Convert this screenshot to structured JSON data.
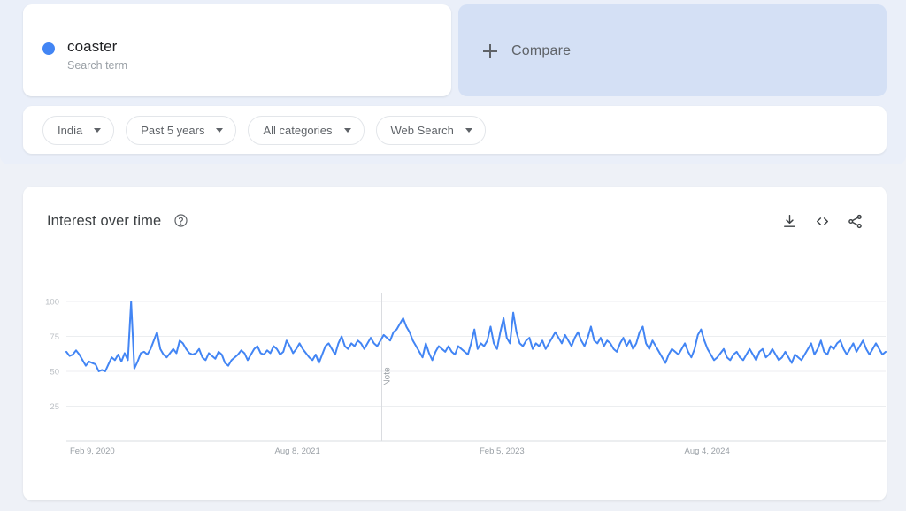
{
  "search_term": {
    "label": "coaster",
    "sublabel": "Search term",
    "dot_color": "#4285f4"
  },
  "compare": {
    "label": "Compare",
    "icon": "plus-icon"
  },
  "filters": [
    {
      "label": "India",
      "icon": "chevron-down-icon"
    },
    {
      "label": "Past 5 years",
      "icon": "chevron-down-icon"
    },
    {
      "label": "All categories",
      "icon": "chevron-down-icon"
    },
    {
      "label": "Web Search",
      "icon": "chevron-down-icon"
    }
  ],
  "chart_card": {
    "title": "Interest over time",
    "help_icon": "help-circle-icon",
    "actions": [
      {
        "name": "download-icon",
        "label": "Download"
      },
      {
        "name": "embed-code-icon",
        "label": "Embed"
      },
      {
        "name": "share-icon",
        "label": "Share"
      }
    ]
  },
  "chart_data": {
    "type": "line",
    "title": "Interest over time",
    "xlabel": "",
    "ylabel": "",
    "ylim": [
      0,
      100
    ],
    "yticks": [
      25,
      50,
      75,
      100
    ],
    "grid": true,
    "legend_position": "none",
    "line_color": "#4285f4",
    "xticks": [
      "Feb 9, 2020",
      "Aug 8, 2021",
      "Feb 5, 2023",
      "Aug 4, 2024"
    ],
    "annotations": [
      {
        "label": "Note",
        "x_fraction": 0.385,
        "orientation": "vertical"
      }
    ],
    "series": [
      {
        "name": "coaster",
        "values": [
          64,
          61,
          62,
          65,
          62,
          58,
          54,
          57,
          56,
          55,
          50,
          51,
          50,
          55,
          60,
          58,
          62,
          57,
          63,
          58,
          100,
          52,
          57,
          63,
          64,
          62,
          66,
          72,
          78,
          66,
          62,
          60,
          63,
          66,
          63,
          72,
          70,
          66,
          63,
          62,
          63,
          66,
          60,
          58,
          63,
          61,
          59,
          64,
          62,
          56,
          54,
          58,
          60,
          62,
          65,
          63,
          58,
          62,
          66,
          68,
          63,
          62,
          65,
          63,
          68,
          66,
          62,
          64,
          72,
          68,
          63,
          66,
          70,
          66,
          63,
          60,
          58,
          62,
          56,
          62,
          68,
          70,
          66,
          62,
          70,
          75,
          68,
          66,
          70,
          68,
          72,
          70,
          66,
          70,
          74,
          70,
          68,
          72,
          76,
          74,
          72,
          78,
          80,
          84,
          88,
          82,
          78,
          72,
          68,
          64,
          60,
          70,
          63,
          58,
          64,
          68,
          66,
          64,
          68,
          64,
          62,
          68,
          66,
          64,
          62,
          70,
          80,
          66,
          70,
          68,
          72,
          82,
          70,
          66,
          78,
          88,
          74,
          70,
          92,
          78,
          70,
          68,
          72,
          74,
          66,
          70,
          68,
          72,
          66,
          70,
          74,
          78,
          74,
          70,
          76,
          72,
          68,
          74,
          78,
          72,
          68,
          74,
          82,
          72,
          70,
          74,
          68,
          72,
          70,
          66,
          64,
          70,
          74,
          68,
          72,
          66,
          70,
          78,
          82,
          70,
          66,
          72,
          68,
          64,
          60,
          56,
          62,
          66,
          64,
          62,
          66,
          70,
          64,
          60,
          66,
          76,
          80,
          72,
          66,
          62,
          58,
          60,
          63,
          66,
          60,
          58,
          62,
          64,
          60,
          58,
          62,
          66,
          62,
          58,
          64,
          66,
          60,
          62,
          66,
          62,
          58,
          60,
          64,
          60,
          56,
          62,
          60,
          58,
          62,
          66,
          70,
          62,
          66,
          72,
          64,
          62,
          68,
          66,
          70,
          72,
          66,
          62,
          66,
          70,
          64,
          68,
          72,
          66,
          62,
          66,
          70,
          66,
          62,
          64
        ]
      }
    ]
  }
}
